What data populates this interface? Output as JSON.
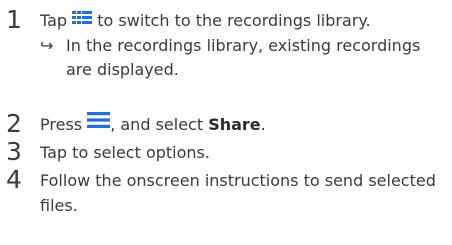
{
  "steps": [
    {
      "number": "1",
      "before_icon": "Tap ",
      "icon": "grid-list-icon",
      "after_icon": " to switch to the recordings library.",
      "result_arrow": "↪",
      "result_text": "In the recordings library, existing recordings are displayed."
    },
    {
      "number": "2",
      "before_icon": "Press ",
      "icon": "menu-icon",
      "after_icon": ", and select ",
      "bold_word": "Share",
      "end": "."
    },
    {
      "number": "3",
      "text": "Tap to select options."
    },
    {
      "number": "4",
      "text": "Follow the onscreen instructions to send selected files."
    }
  ],
  "colors": {
    "text": "#3b3b3b",
    "icon_blue": "#1e6fd9"
  }
}
